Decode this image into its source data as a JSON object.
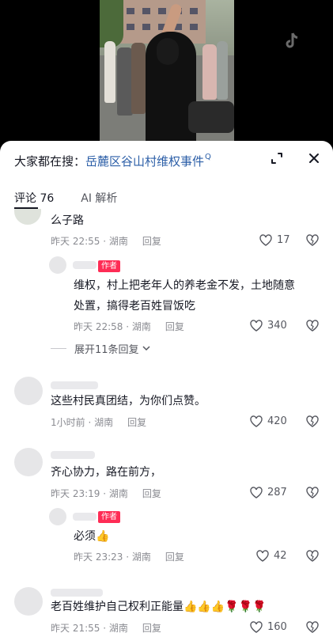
{
  "video": {
    "icon": "tiktok-logo-icon"
  },
  "search": {
    "prefix": "大家都在搜：",
    "query": "岳麓区谷山村维权事件",
    "mark": "Q"
  },
  "tabs": [
    {
      "label": "评论 76"
    },
    {
      "label": "AI 解析"
    }
  ],
  "comments": [
    {
      "text_lines": [
        "么子路"
      ],
      "time": "昨天 22:55 · 湖南",
      "reply_label": "回复",
      "likes": "17"
    },
    {
      "author_tag": "作者",
      "text_lines": [
        "维权，村上把老年人的养老金不发，土地随意",
        "处置，搞得老百姓冒饭吃"
      ],
      "time": "昨天 22:58 · 湖南",
      "reply_label": "回复",
      "likes": "340"
    },
    {
      "text_lines": [
        "这些村民真团结，为你们点赞。"
      ],
      "time": "1小时前 · 湖南",
      "reply_label": "回复",
      "likes": "420"
    },
    {
      "text_lines": [
        "齐心协力，路在前方，"
      ],
      "time": "昨天 23:19 · 湖南",
      "reply_label": "回复",
      "likes": "287"
    },
    {
      "author_tag": "作者",
      "text_lines": [
        "必须👍"
      ],
      "time": "昨天 23:23 · 湖南",
      "reply_label": "回复",
      "likes": "42"
    },
    {
      "text_lines": [
        "老百姓维护自己权利正能量👍👍👍🌹🌹🌹"
      ],
      "time": "昨天 21:55 · 湖南",
      "reply_label": "回复",
      "likes": "160"
    }
  ],
  "expand_replies": "展开11条回复",
  "colors": {
    "link": "#2b5ea7",
    "author_tag": "#fe2c55",
    "meta": "#8a8b91"
  }
}
